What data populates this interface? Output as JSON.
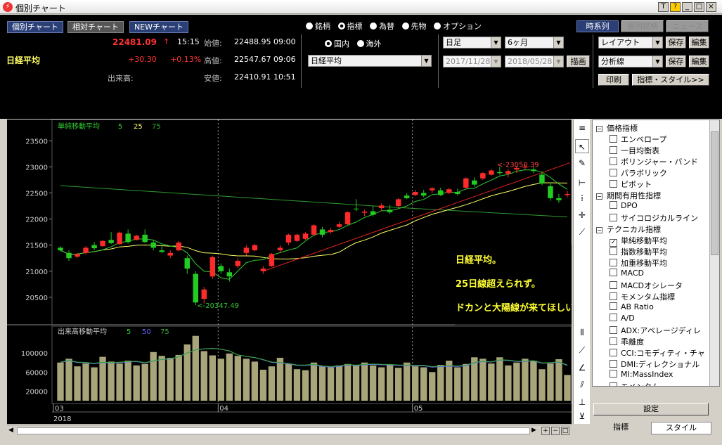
{
  "window": {
    "title": "個別チャート",
    "buttons": [
      "T",
      "?",
      "_",
      "□",
      "×"
    ]
  },
  "tabs_left": [
    "個別チャート",
    "相対チャート",
    "NEWチャート"
  ],
  "quote": {
    "name": "日経平均",
    "last": "22481.09",
    "arrow": "↑",
    "time": "15:15",
    "change": "+30.30",
    "change_pct": "+0.13%",
    "open_label": "始値:",
    "open": "22488.95 09:00",
    "high_label": "高値:",
    "high": "22547.67 09:06",
    "low_label": "安値:",
    "low": "22410.91 10:51",
    "volume_label": "出来高:"
  },
  "categories": {
    "items": [
      "銘柄",
      "指標",
      "為替",
      "先物",
      "オプション"
    ],
    "selected": "指標"
  },
  "region": {
    "items": [
      "国内",
      "海外"
    ],
    "selected": "国内"
  },
  "index_select": "日経平均",
  "period_select": "日足",
  "range_select": "6ヶ月",
  "date_from": "2017/11/28",
  "date_to": "2018/05/28",
  "draw_button": "描画",
  "right_tabs": [
    "時系列",
    "個別銘柄",
    "ニュース"
  ],
  "layout_select": "レイアウト",
  "analysis_select": "分析線",
  "save_label": "保存",
  "edit_label": "編集",
  "print_label": "印刷",
  "style_button": "指標・スタイル>>",
  "chart_data": {
    "type": "candlestick",
    "main_legend": {
      "label": "単純移動平均",
      "periods": [
        "5",
        "25",
        "75"
      ],
      "colors": [
        "#33cc33",
        "#ffff66",
        "#33aa33"
      ]
    },
    "ylim": [
      20000,
      23800
    ],
    "yticks": [
      20500,
      21000,
      21500,
      22000,
      22500,
      23000,
      23500
    ],
    "y_tick_labels": [
      "20500",
      "21000",
      "21500",
      "22000",
      "22500",
      "23000",
      "23500"
    ],
    "high_annotation": "<-23050.39",
    "low_annotation": "<-20347.49",
    "candles": [
      [
        21450,
        21480,
        21380,
        21400
      ],
      [
        21350,
        21400,
        21200,
        21250
      ],
      [
        21280,
        21350,
        21250,
        21330
      ],
      [
        21350,
        21480,
        21320,
        21450
      ],
      [
        21500,
        21560,
        21400,
        21440
      ],
      [
        21480,
        21600,
        21470,
        21580
      ],
      [
        21600,
        21750,
        21520,
        21540
      ],
      [
        21520,
        21760,
        21500,
        21740
      ],
      [
        21720,
        21800,
        21530,
        21560
      ],
      [
        21600,
        21700,
        21590,
        21680
      ],
      [
        21700,
        21800,
        21540,
        21560
      ],
      [
        21550,
        21600,
        21400,
        21450
      ],
      [
        21400,
        21500,
        21350,
        21370
      ],
      [
        21300,
        21400,
        21250,
        21350
      ],
      [
        21400,
        21580,
        21380,
        21550
      ],
      [
        21250,
        21300,
        20950,
        21050
      ],
      [
        20950,
        21000,
        20347,
        20400
      ],
      [
        20470,
        20700,
        20380,
        20650
      ],
      [
        20900,
        21300,
        20850,
        21270
      ],
      [
        21100,
        21150,
        20950,
        21000
      ],
      [
        20980,
        21050,
        20800,
        20900
      ],
      [
        21100,
        21250,
        21050,
        21200
      ],
      [
        21350,
        21500,
        21300,
        21450
      ],
      [
        21400,
        21520,
        21380,
        21500
      ],
      [
        21000,
        21100,
        20950,
        21050
      ],
      [
        21100,
        21350,
        21080,
        21330
      ],
      [
        21400,
        21500,
        21350,
        21450
      ],
      [
        21550,
        21720,
        21500,
        21700
      ],
      [
        21580,
        21720,
        21560,
        21700
      ],
      [
        21620,
        21750,
        21600,
        21720
      ],
      [
        21700,
        21900,
        21680,
        21880
      ],
      [
        21800,
        21850,
        21650,
        21700
      ],
      [
        21750,
        21830,
        21720,
        21790
      ],
      [
        21850,
        21950,
        21830,
        21900
      ],
      [
        21900,
        22150,
        21880,
        22130
      ],
      [
        22200,
        22380,
        22150,
        22190
      ],
      [
        22120,
        22180,
        22060,
        22140
      ],
      [
        22150,
        22250,
        22050,
        22080
      ],
      [
        22210,
        22300,
        22150,
        22260
      ],
      [
        22180,
        22270,
        22100,
        22130
      ],
      [
        22250,
        22400,
        22220,
        22380
      ],
      [
        22450,
        22500,
        22380,
        22400
      ],
      [
        22460,
        22560,
        22440,
        22520
      ],
      [
        22500,
        22560,
        22420,
        22450
      ],
      [
        22550,
        22610,
        22500,
        22590
      ],
      [
        22550,
        22600,
        22440,
        22460
      ],
      [
        22500,
        22600,
        22480,
        22570
      ],
      [
        22520,
        22580,
        22450,
        22480
      ],
      [
        22600,
        22800,
        22580,
        22780
      ],
      [
        22740,
        22800,
        22620,
        22660
      ],
      [
        22780,
        22900,
        22750,
        22880
      ],
      [
        22850,
        22960,
        22830,
        22930
      ],
      [
        22900,
        23000,
        22850,
        22880
      ],
      [
        22870,
        22950,
        22800,
        22920
      ],
      [
        22950,
        23020,
        22880,
        22980
      ],
      [
        23000,
        23050,
        22950,
        23000
      ],
      [
        22950,
        23000,
        22880,
        22920
      ],
      [
        22850,
        22900,
        22650,
        22680
      ],
      [
        22630,
        22700,
        22350,
        22400
      ],
      [
        22400,
        22480,
        22310,
        22360
      ],
      [
        22460,
        22540,
        22420,
        22481
      ]
    ],
    "x_tick_labels": [
      "03",
      "04",
      "05"
    ],
    "x_year_label": "2018",
    "volume_legend": {
      "label": "出来高移動平均",
      "periods": [
        "5",
        "50",
        "75"
      ],
      "colors": [
        "#33cc33",
        "#6666ff",
        "#33aa33"
      ]
    },
    "volume_yticks": [
      20000,
      60000,
      100000
    ],
    "volume_ylim": [
      0,
      140000
    ],
    "volume_y_tick_labels": [
      "20000",
      "60000",
      "100000"
    ],
    "volume": [
      80000,
      88000,
      72000,
      78000,
      70000,
      92000,
      82000,
      78000,
      84000,
      74000,
      77000,
      102000,
      94000,
      90000,
      96000,
      118000,
      136000,
      104000,
      95000,
      88000,
      99000,
      94000,
      88000,
      82000,
      65000,
      72000,
      90000,
      77000,
      66000,
      64000,
      80000,
      72000,
      70000,
      74000,
      77000,
      75000,
      80000,
      74000,
      70000,
      76000,
      69000,
      80000,
      72000,
      70000,
      60000,
      75000,
      84000,
      70000,
      77000,
      91000,
      88000,
      78000,
      91000,
      74000,
      80000,
      88000,
      84000,
      66000,
      78000,
      87000,
      54000
    ],
    "annotation_lines": [
      "日経平均。",
      "25日線超えられず。",
      "ドカンと大陽線が来てほしい。"
    ]
  },
  "sidebar": {
    "groups": [
      {
        "label": "価格指標",
        "items": [
          "エンベロープ",
          "一目均衡表",
          "ボリンジャー・バンド",
          "パラボリック",
          "ピボット"
        ]
      },
      {
        "label": "期間有用性指標",
        "items": [
          "DPO",
          "サイコロジカルライン"
        ]
      },
      {
        "label": "テクニカル指標",
        "items": [
          "単純移動平均",
          "指数移動平均",
          "加重移動平均",
          "MACD",
          "MACDオシレータ",
          "モメンタム指標",
          "AB Ratio",
          "A/D",
          "ADX:アベレージディレ",
          "乖離度",
          "CCI:コモディティ・チャ",
          "DMI:ディレクショナル",
          "MI:MassIndex",
          "モメンタム"
        ]
      }
    ],
    "checked": "単純移動平均"
  },
  "settei_button": "設定",
  "bottom_tabs": [
    "指標",
    "スタイル"
  ]
}
